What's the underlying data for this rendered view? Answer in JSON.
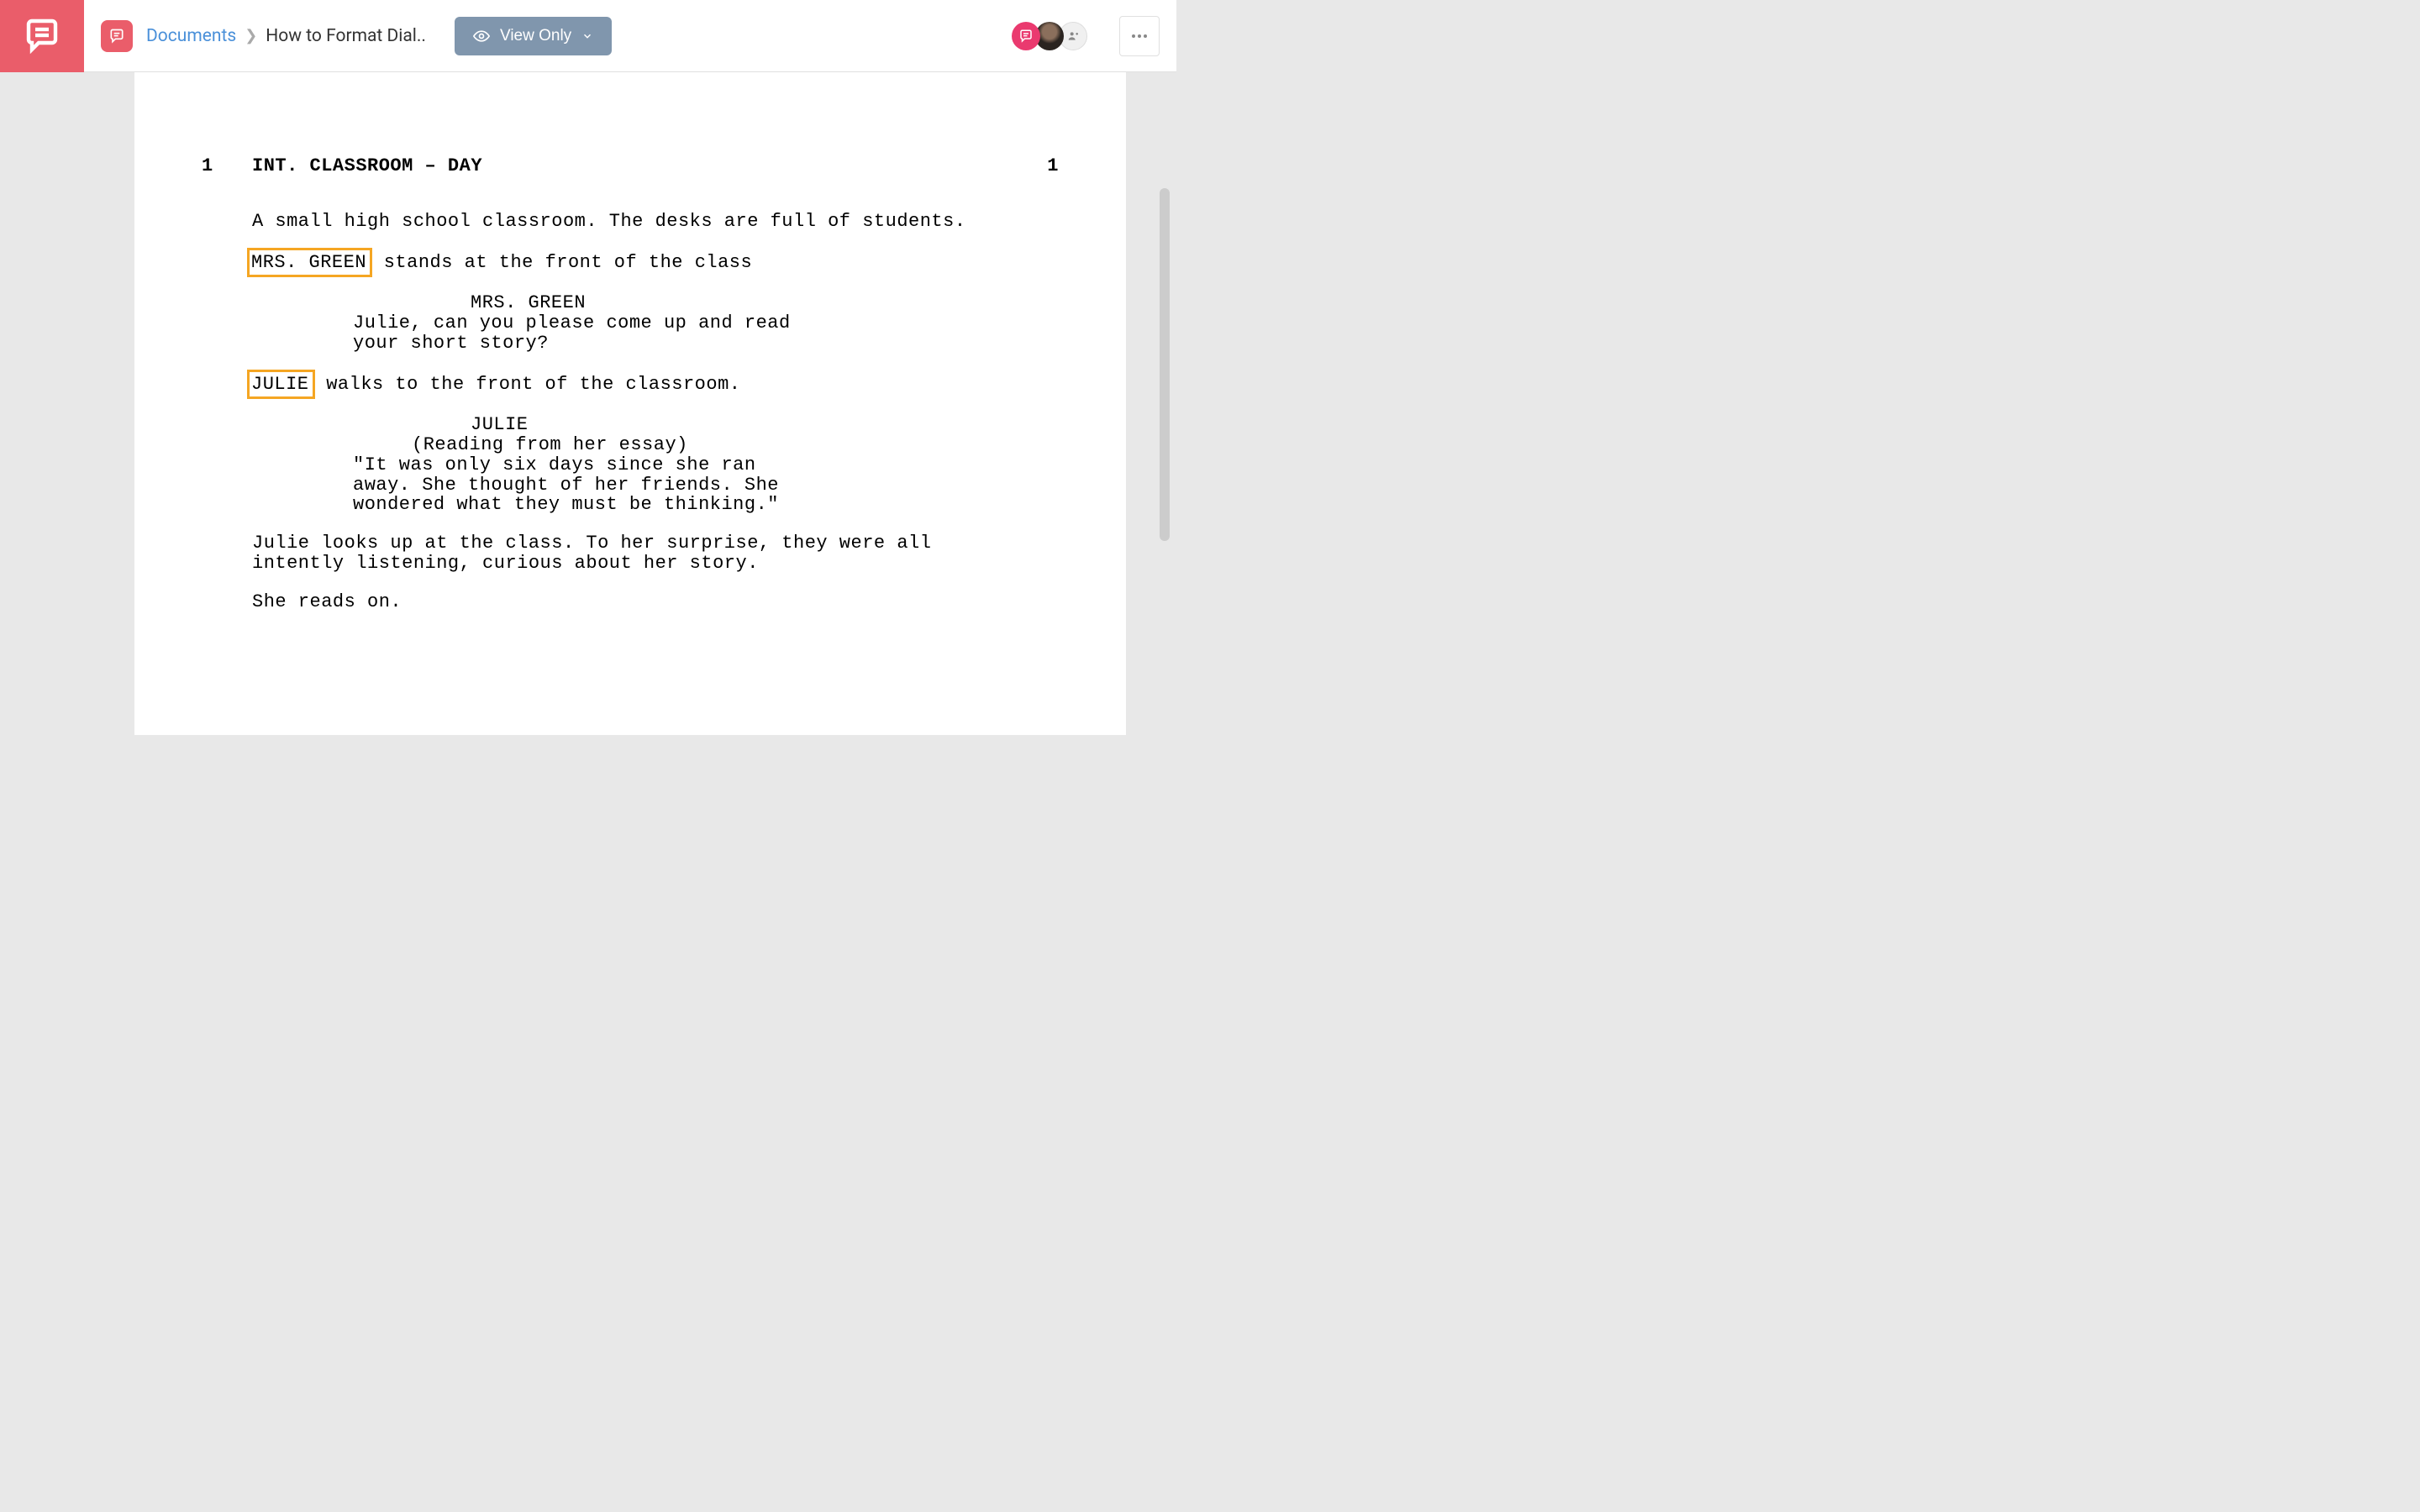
{
  "header": {
    "breadcrumb_root": "Documents",
    "breadcrumb_current": "How to Format Dial..",
    "view_mode_label": "View Only"
  },
  "script": {
    "scene_number": "1",
    "scene_heading": "INT. CLASSROOM – DAY",
    "action_1": "A small high school classroom. The desks are full of students.",
    "action_2_highlight": "MRS. GREEN",
    "action_2_rest": " stands at the front of the class",
    "char_1": "MRS. GREEN",
    "dialogue_1": "Julie, can you please come up and read your short story?",
    "action_3_highlight": "JULIE",
    "action_3_rest": " walks to the front of the classroom.",
    "char_2": "JULIE",
    "paren_2": "(Reading from her essay)",
    "dialogue_2": "\"It was only six days since she ran away. She thought of her friends. She wondered what they must be thinking.\"",
    "action_4": "Julie looks up at the class. To her surprise, they were all intently listening, curious about her story.",
    "action_5": "She reads on."
  }
}
